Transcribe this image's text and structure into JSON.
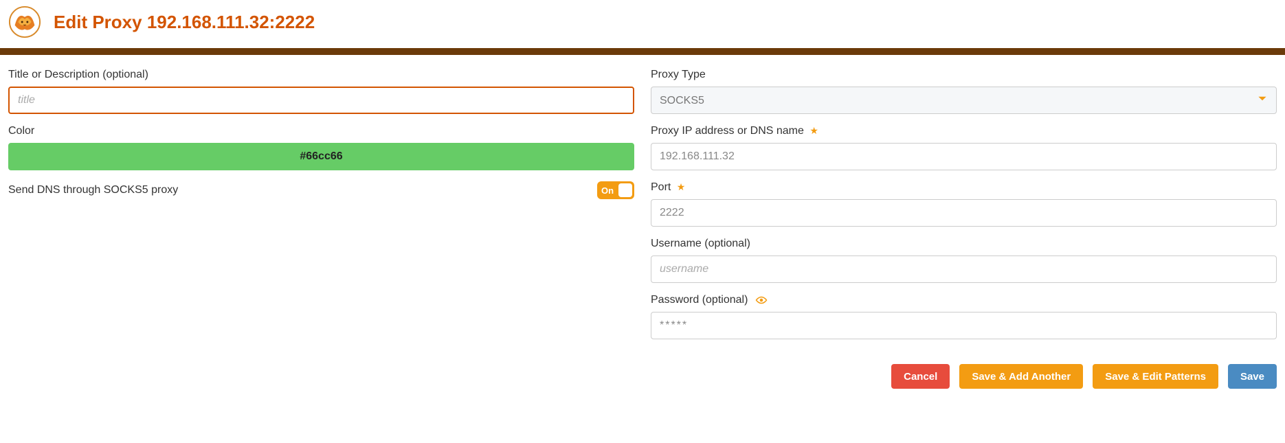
{
  "header": {
    "title": "Edit Proxy 192.168.111.32:2222"
  },
  "left": {
    "title_label": "Title or Description (optional)",
    "title_placeholder": "title",
    "title_value": "",
    "color_label": "Color",
    "color_value": "#66cc66",
    "dns_label": "Send DNS through SOCKS5 proxy",
    "dns_toggle_text": "On"
  },
  "right": {
    "proxy_type_label": "Proxy Type",
    "proxy_type_value": "SOCKS5",
    "ip_label": "Proxy IP address or DNS name",
    "ip_value": "192.168.111.32",
    "port_label": "Port",
    "port_value": "2222",
    "username_label": "Username (optional)",
    "username_placeholder": "username",
    "username_value": "",
    "password_label": "Password (optional)",
    "password_value": "*****"
  },
  "buttons": {
    "cancel": "Cancel",
    "save_add": "Save & Add Another",
    "save_edit": "Save & Edit Patterns",
    "save": "Save"
  }
}
